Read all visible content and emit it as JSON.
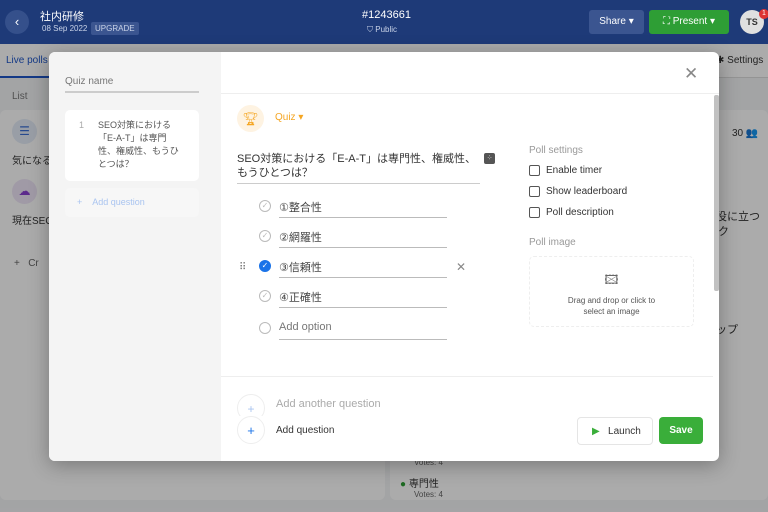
{
  "header": {
    "title": "社内研修",
    "date": "08 Sep 2022",
    "upgrade": "UPGRADE",
    "event_id": "#1243661",
    "visibility": "Public",
    "share": "Share",
    "present": "Present",
    "avatar": "TS",
    "notification_count": "1"
  },
  "page": {
    "tab_live_polls": "Live polls",
    "settings": "Settings",
    "list": "List",
    "poll_1": "気になる",
    "poll_2": "現在SEO",
    "create": "Cr",
    "participants": "30",
    "right_text_1": "役に立つ",
    "right_text_2": "ク",
    "right_text_3": "ップ",
    "votes_1": "Votes: 4",
    "option_label": "専門性",
    "votes_2": "Votes: 4"
  },
  "modal": {
    "quiz_name_placeholder": "Quiz name",
    "questions": [
      {
        "number": "1",
        "text": "SEO対策における「E-A-T」は専門性、権威性、もうひとつは？"
      }
    ],
    "add_question_side": "Add question",
    "type": "Quiz",
    "question_text": "SEO対策における「E-A-T」は専門性、権威性、もうひとつは？",
    "options": [
      {
        "label": "①整合性",
        "correct": false
      },
      {
        "label": "②網羅性",
        "correct": false
      },
      {
        "label": "③信頼性",
        "correct": true
      },
      {
        "label": "④正確性",
        "correct": false
      }
    ],
    "add_option_placeholder": "Add option",
    "poll_settings_title": "Poll settings",
    "settings": [
      {
        "label": "Enable timer",
        "checked": false
      },
      {
        "label": "Show leaderboard",
        "checked": false
      },
      {
        "label": "Poll description",
        "checked": false
      }
    ],
    "poll_image_title": "Poll image",
    "dropzone_text": "Drag and drop or click to select an image",
    "add_another_question": "Add another question",
    "add_question": "Add question",
    "launch": "Launch",
    "save": "Save"
  },
  "colors": {
    "header": "#1e3a78",
    "present": "#2e9e35",
    "save": "#3aae3a",
    "quiz_accent": "#f5a623",
    "correct": "#1a73e8"
  }
}
